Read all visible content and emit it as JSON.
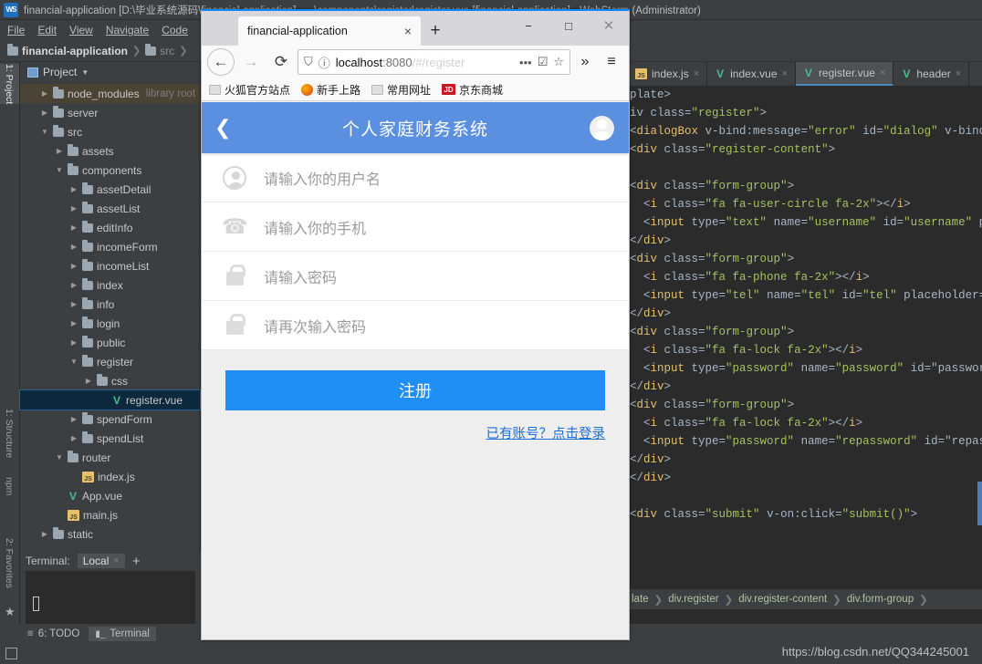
{
  "ide": {
    "window_title": "financial-application [D:\\毕业系统源码\\financial-application] - ...\\components\\register\\register.vue [financial-application] - WebStorm (Administrator)",
    "logo_text": "WS",
    "menus": [
      "File",
      "Edit",
      "View",
      "Navigate",
      "Code"
    ],
    "breadcrumbs": [
      "financial-application",
      "src"
    ],
    "tool_strip": [
      "1: Project",
      "1: Structure",
      "npm",
      "2: Favorites"
    ],
    "project_panel": {
      "header": "Project",
      "tree": [
        {
          "label": "node_modules",
          "sub": "library root",
          "icon": "folder",
          "arrow": "collapsed",
          "indent": 1,
          "state": "highlighted"
        },
        {
          "label": "server",
          "sub": "",
          "icon": "folder",
          "arrow": "collapsed",
          "indent": 1,
          "state": ""
        },
        {
          "label": "src",
          "sub": "",
          "icon": "folder",
          "arrow": "expanded",
          "indent": 1,
          "state": ""
        },
        {
          "label": "assets",
          "sub": "",
          "icon": "folder",
          "arrow": "collapsed",
          "indent": 2,
          "state": ""
        },
        {
          "label": "components",
          "sub": "",
          "icon": "folder",
          "arrow": "expanded",
          "indent": 2,
          "state": ""
        },
        {
          "label": "assetDetail",
          "sub": "",
          "icon": "folder",
          "arrow": "collapsed",
          "indent": 3,
          "state": ""
        },
        {
          "label": "assetList",
          "sub": "",
          "icon": "folder",
          "arrow": "collapsed",
          "indent": 3,
          "state": ""
        },
        {
          "label": "editInfo",
          "sub": "",
          "icon": "folder",
          "arrow": "collapsed",
          "indent": 3,
          "state": ""
        },
        {
          "label": "incomeForm",
          "sub": "",
          "icon": "folder",
          "arrow": "collapsed",
          "indent": 3,
          "state": ""
        },
        {
          "label": "incomeList",
          "sub": "",
          "icon": "folder",
          "arrow": "collapsed",
          "indent": 3,
          "state": ""
        },
        {
          "label": "index",
          "sub": "",
          "icon": "folder",
          "arrow": "collapsed",
          "indent": 3,
          "state": ""
        },
        {
          "label": "info",
          "sub": "",
          "icon": "folder",
          "arrow": "collapsed",
          "indent": 3,
          "state": ""
        },
        {
          "label": "login",
          "sub": "",
          "icon": "folder",
          "arrow": "collapsed",
          "indent": 3,
          "state": ""
        },
        {
          "label": "public",
          "sub": "",
          "icon": "folder",
          "arrow": "collapsed",
          "indent": 3,
          "state": ""
        },
        {
          "label": "register",
          "sub": "",
          "icon": "folder",
          "arrow": "expanded",
          "indent": 3,
          "state": ""
        },
        {
          "label": "css",
          "sub": "",
          "icon": "folder",
          "arrow": "collapsed",
          "indent": 4,
          "state": ""
        },
        {
          "label": "register.vue",
          "sub": "",
          "icon": "vue",
          "arrow": "none",
          "indent": 5,
          "state": "selected"
        },
        {
          "label": "spendForm",
          "sub": "",
          "icon": "folder",
          "arrow": "collapsed",
          "indent": 3,
          "state": ""
        },
        {
          "label": "spendList",
          "sub": "",
          "icon": "folder",
          "arrow": "collapsed",
          "indent": 3,
          "state": ""
        },
        {
          "label": "router",
          "sub": "",
          "icon": "folder",
          "arrow": "expanded",
          "indent": 2,
          "state": ""
        },
        {
          "label": "index.js",
          "sub": "",
          "icon": "js",
          "arrow": "none",
          "indent": 3,
          "state": ""
        },
        {
          "label": "App.vue",
          "sub": "",
          "icon": "vue",
          "arrow": "none",
          "indent": 2,
          "state": ""
        },
        {
          "label": "main.js",
          "sub": "",
          "icon": "js",
          "arrow": "none",
          "indent": 2,
          "state": ""
        },
        {
          "label": "static",
          "sub": "",
          "icon": "folder",
          "arrow": "collapsed",
          "indent": 1,
          "state": ""
        }
      ]
    },
    "terminal": {
      "label": "Terminal:",
      "tab": "Local",
      "close": "×",
      "add": "+"
    },
    "status_bar": {
      "todo": "6: TODO",
      "todo_prefix": "6",
      "terminal": "Terminal"
    },
    "editor": {
      "tabs": [
        {
          "label": "index.js",
          "icon": "js",
          "active": false
        },
        {
          "label": "index.vue",
          "icon": "vue",
          "active": false
        },
        {
          "label": "register.vue",
          "icon": "vue",
          "active": true
        },
        {
          "label": "header",
          "icon": "vue",
          "active": false
        }
      ],
      "code_lines": [
        "plate>",
        "iv class=\"register\">",
        "<dialogBox v-bind:message=\"error\" id=\"dialog\" v-bind:hr",
        "<div class=\"register-content\">",
        "",
        "<div class=\"form-group\">",
        "  <i class=\"fa fa-user-circle fa-2x\"></i>",
        "  <input type=\"text\" name=\"username\" id=\"username\" pl",
        "</div>",
        "<div class=\"form-group\">",
        "  <i class=\"fa fa-phone fa-2x\"></i>",
        "  <input type=\"tel\" name=\"tel\" id=\"tel\" placeholder=\"",
        "</div>",
        "<div class=\"form-group\">",
        "  <i class=\"fa fa-lock fa-2x\"></i>",
        "  <input type=\"password\" name=\"password\" id=\"password",
        "</div>",
        "<div class=\"form-group\">",
        "  <i class=\"fa fa-lock fa-2x\"></i>",
        "  <input type=\"password\" name=\"repassword\" id=\"repass",
        "</div>",
        "</div>",
        "",
        "<div class=\"submit\" v-on:click=\"submit()\">"
      ],
      "breadcrumbs": [
        "late",
        "div.register",
        "div.register-content",
        "div.form-group"
      ]
    },
    "watermark": "https://blog.csdn.net/QQ344245001"
  },
  "browser": {
    "tab_title": "financial-application",
    "tab_close": "×",
    "new_tab": "+",
    "window_buttons": {
      "minimize": "−",
      "maximize": "□",
      "close": "✕"
    },
    "nav": {
      "back": "←",
      "forward": "→",
      "reload": "⟳",
      "menu": "≡",
      "overflow": "»"
    },
    "url": {
      "host": "localhost",
      "port": ":8080",
      "path": "/#/register",
      "info_icon": "ⓘ",
      "shield_icon": "⛉",
      "actions": "•••",
      "pocket": "☑",
      "star": "☆"
    },
    "bookmarks": [
      {
        "label": "火狐官方站点",
        "icon": "folder"
      },
      {
        "label": "新手上路",
        "icon": "firefox"
      },
      {
        "label": "常用网址",
        "icon": "folder"
      },
      {
        "label": "京东商城",
        "icon": "jd"
      }
    ]
  },
  "app": {
    "header": {
      "title": "个人家庭财务系统",
      "back": "❮",
      "avatar": "user-avatar"
    },
    "accent_color": "#5b8fe0",
    "button_color": "#1f8ff5",
    "form_fields": [
      {
        "icon": "user-circle-icon",
        "placeholder": "请输入你的用户名",
        "value": ""
      },
      {
        "icon": "phone-icon",
        "placeholder": "请输入你的手机",
        "value": ""
      },
      {
        "icon": "lock-icon",
        "placeholder": "请输入密码",
        "value": ""
      },
      {
        "icon": "lock-icon",
        "placeholder": "请再次输入密码",
        "value": ""
      }
    ],
    "submit_label": "注册",
    "login_link": "已有账号？点击登录"
  }
}
